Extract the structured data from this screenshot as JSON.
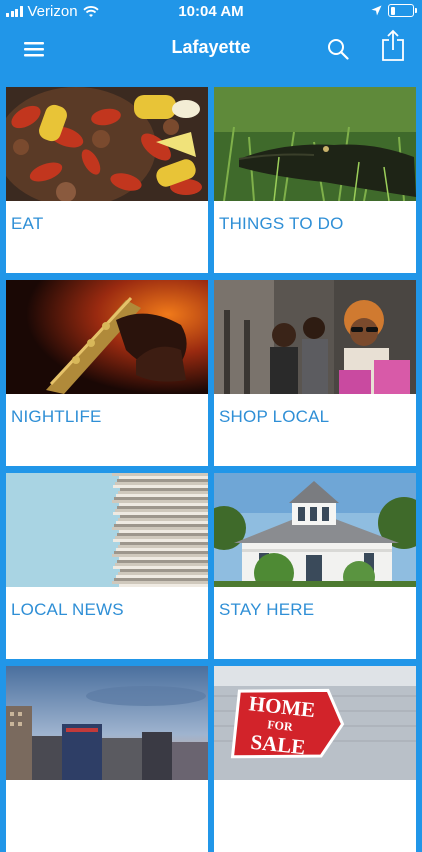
{
  "status_bar": {
    "carrier": "Verizon",
    "time": "10:04 AM",
    "battery_level": 0.25
  },
  "header": {
    "title": "Lafayette"
  },
  "tiles": [
    {
      "label": "EAT",
      "image": "crawfish-boil"
    },
    {
      "label": "THINGS TO DO",
      "image": "alligator-in-grass"
    },
    {
      "label": "NIGHTLIFE",
      "image": "saxophone-player"
    },
    {
      "label": "SHOP LOCAL",
      "image": "shoppers-with-bags"
    },
    {
      "label": "LOCAL NEWS",
      "image": "newspaper-stack"
    },
    {
      "label": "STAY HERE",
      "image": "white-house"
    },
    {
      "label": "",
      "image": "city-skyline"
    },
    {
      "label": "",
      "image": "home-for-sale-sign",
      "sign_text": [
        "HOME",
        "FOR",
        "SALE"
      ]
    }
  ],
  "colors": {
    "brand_blue": "#2196e8",
    "label_blue": "#2f8fd6"
  }
}
